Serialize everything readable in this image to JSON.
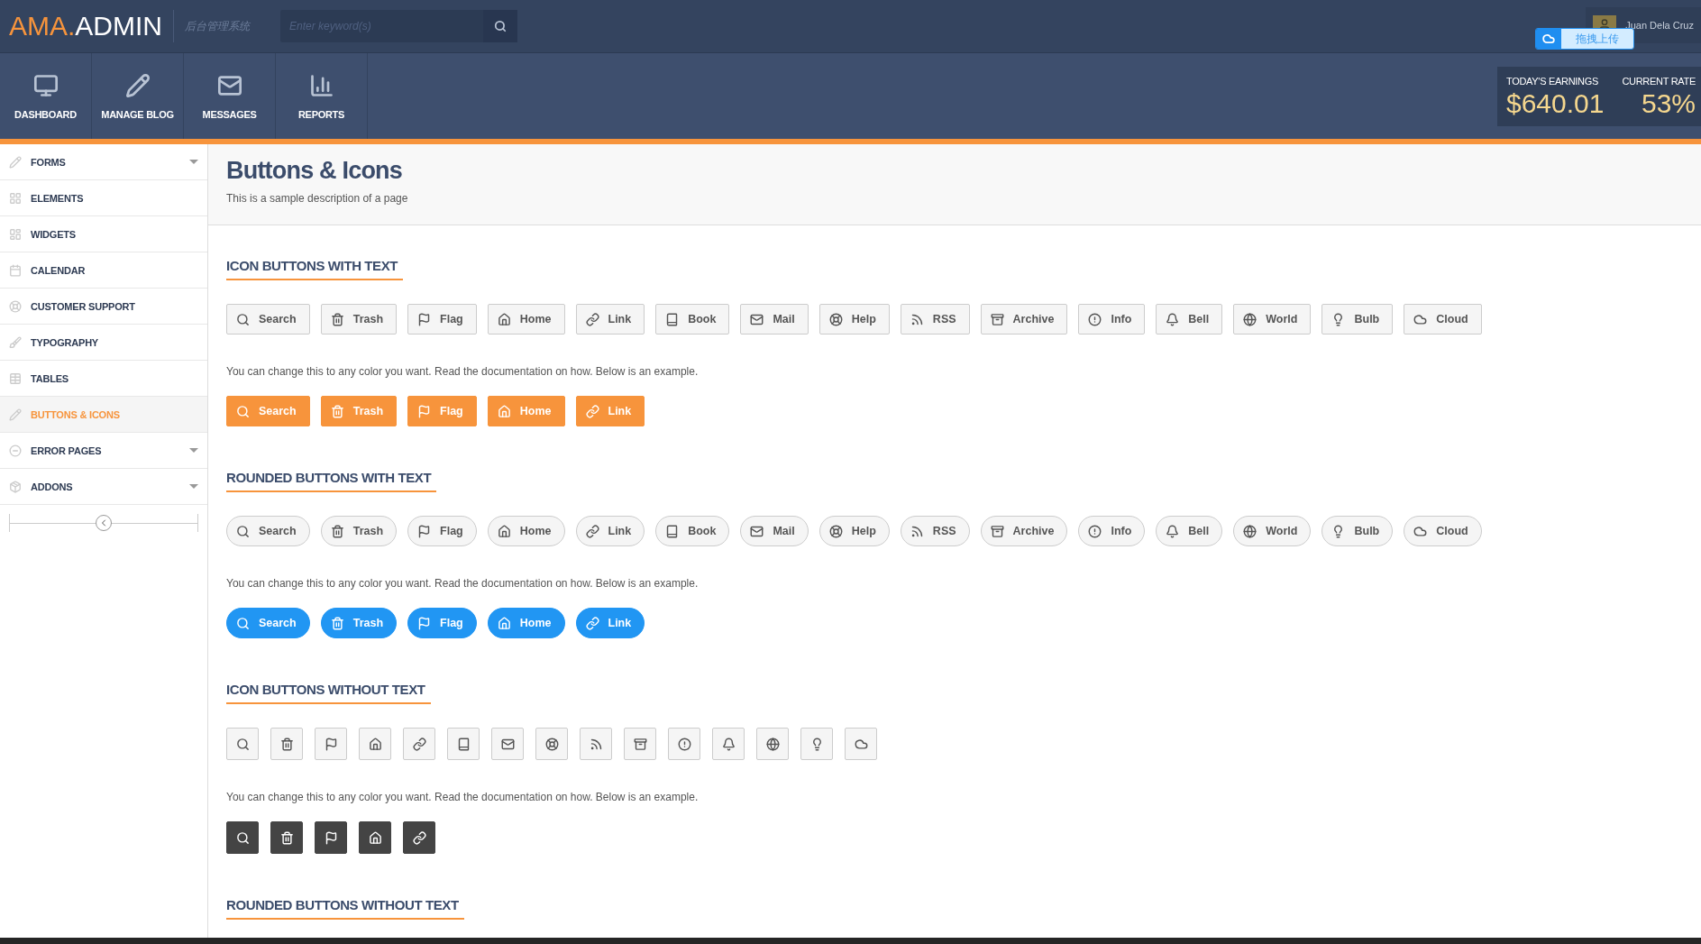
{
  "brand": {
    "prefix": "AMA.",
    "name": "ADMIN",
    "subtitle": "后台管理系统"
  },
  "search": {
    "placeholder": "Enter keyword(s)"
  },
  "user": {
    "name": "Juan Dela Cruz"
  },
  "upload": {
    "label": "拖拽上传"
  },
  "nav": [
    {
      "label": "DASHBOARD",
      "kind": "monitor"
    },
    {
      "label": "MANAGE BLOG",
      "kind": "pencil"
    },
    {
      "label": "MESSAGES",
      "kind": "mail"
    },
    {
      "label": "REPORTS",
      "kind": "chart"
    }
  ],
  "stats": [
    {
      "label": "TODAY'S EARNINGS",
      "value": "$640.01"
    },
    {
      "label": "CURRENT RATE",
      "value": "53%"
    }
  ],
  "sidebar": {
    "items": [
      {
        "label": "FORMS",
        "kind": "pencil",
        "selected": false,
        "has_submenu": true
      },
      {
        "label": "ELEMENTS",
        "kind": "grid",
        "selected": false,
        "has_submenu": false
      },
      {
        "label": "WIDGETS",
        "kind": "widgets",
        "selected": false,
        "has_submenu": false
      },
      {
        "label": "CALENDAR",
        "kind": "calendar",
        "selected": false,
        "has_submenu": false
      },
      {
        "label": "CUSTOMER SUPPORT",
        "kind": "help",
        "selected": false,
        "has_submenu": false
      },
      {
        "label": "TYPOGRAPHY",
        "kind": "brush",
        "selected": false,
        "has_submenu": false
      },
      {
        "label": "TABLES",
        "kind": "table",
        "selected": false,
        "has_submenu": false
      },
      {
        "label": "BUTTONS & ICONS",
        "kind": "pencil",
        "selected": true,
        "has_submenu": false
      },
      {
        "label": "ERROR PAGES",
        "kind": "minus",
        "selected": false,
        "has_submenu": true
      },
      {
        "label": "ADDONS",
        "kind": "box",
        "selected": false,
        "has_submenu": true
      }
    ]
  },
  "page": {
    "title": "Buttons & Icons",
    "description": "This is a sample description of a page"
  },
  "sections": [
    {
      "title": "ICON BUTTONS WITH TEXT",
      "rounded": false,
      "color": "#f7943c",
      "note": "You can change this to any color you want. Read the documentation on how. Below is an example.",
      "buttons": [
        {
          "label": "Search",
          "kind": "search"
        },
        {
          "label": "Trash",
          "kind": "trash"
        },
        {
          "label": "Flag",
          "kind": "flag"
        },
        {
          "label": "Home",
          "kind": "home"
        },
        {
          "label": "Link",
          "kind": "link"
        },
        {
          "label": "Book",
          "kind": "book"
        },
        {
          "label": "Mail",
          "kind": "mail"
        },
        {
          "label": "Help",
          "kind": "help"
        },
        {
          "label": "RSS",
          "kind": "rss"
        },
        {
          "label": "Archive",
          "kind": "archive"
        },
        {
          "label": "Info",
          "kind": "info"
        },
        {
          "label": "Bell",
          "kind": "bell"
        },
        {
          "label": "World",
          "kind": "world"
        },
        {
          "label": "Bulb",
          "kind": "bulb"
        },
        {
          "label": "Cloud",
          "kind": "cloud"
        }
      ],
      "colored_buttons": [
        {
          "label": "Search",
          "kind": "search"
        },
        {
          "label": "Trash",
          "kind": "trash"
        },
        {
          "label": "Flag",
          "kind": "flag"
        },
        {
          "label": "Home",
          "kind": "home"
        },
        {
          "label": "Link",
          "kind": "link"
        }
      ]
    },
    {
      "title": "ROUNDED BUTTONS WITH TEXT",
      "rounded": true,
      "color": "#2196f3",
      "note": "You can change this to any color you want. Read the documentation on how. Below is an example.",
      "buttons": [
        {
          "label": "Search",
          "kind": "search"
        },
        {
          "label": "Trash",
          "kind": "trash"
        },
        {
          "label": "Flag",
          "kind": "flag"
        },
        {
          "label": "Home",
          "kind": "home"
        },
        {
          "label": "Link",
          "kind": "link"
        },
        {
          "label": "Book",
          "kind": "book"
        },
        {
          "label": "Mail",
          "kind": "mail"
        },
        {
          "label": "Help",
          "kind": "help"
        },
        {
          "label": "RSS",
          "kind": "rss"
        },
        {
          "label": "Archive",
          "kind": "archive"
        },
        {
          "label": "Info",
          "kind": "info"
        },
        {
          "label": "Bell",
          "kind": "bell"
        },
        {
          "label": "World",
          "kind": "world"
        },
        {
          "label": "Bulb",
          "kind": "bulb"
        },
        {
          "label": "Cloud",
          "kind": "cloud"
        }
      ],
      "colored_buttons": [
        {
          "label": "Search",
          "kind": "search"
        },
        {
          "label": "Trash",
          "kind": "trash"
        },
        {
          "label": "Flag",
          "kind": "flag"
        },
        {
          "label": "Home",
          "kind": "home"
        },
        {
          "label": "Link",
          "kind": "link"
        }
      ]
    },
    {
      "title": "ICON BUTTONS WITHOUT TEXT",
      "rounded": false,
      "color": "#444444",
      "note": "You can change this to any color you want. Read the documentation on how. Below is an example.",
      "buttons": [
        {
          "kind": "search"
        },
        {
          "kind": "trash"
        },
        {
          "kind": "flag"
        },
        {
          "kind": "home"
        },
        {
          "kind": "link"
        },
        {
          "kind": "book"
        },
        {
          "kind": "mail"
        },
        {
          "kind": "help"
        },
        {
          "kind": "rss"
        },
        {
          "kind": "archive"
        },
        {
          "kind": "info"
        },
        {
          "kind": "bell"
        },
        {
          "kind": "world"
        },
        {
          "kind": "bulb"
        },
        {
          "kind": "cloud"
        }
      ],
      "colored_buttons": [
        {
          "kind": "search"
        },
        {
          "kind": "trash"
        },
        {
          "kind": "flag"
        },
        {
          "kind": "home"
        },
        {
          "kind": "link"
        }
      ]
    },
    {
      "title": "ROUNDED BUTTONS WITHOUT TEXT"
    }
  ]
}
